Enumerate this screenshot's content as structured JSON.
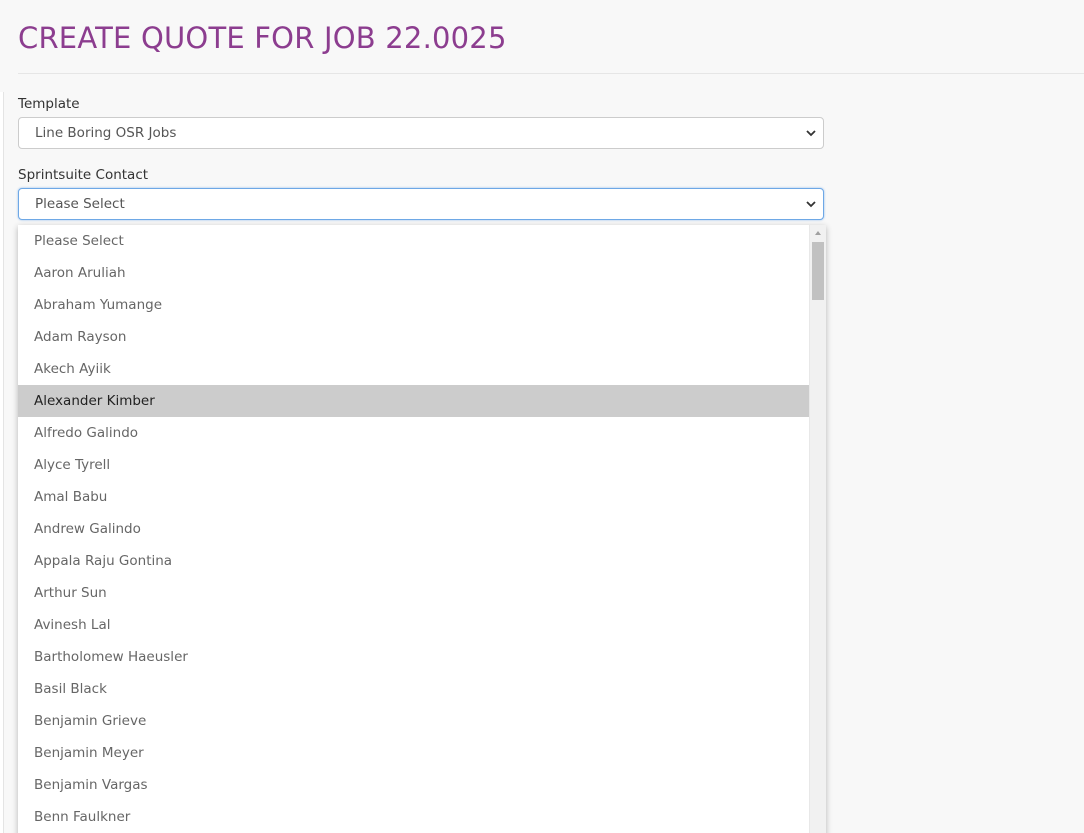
{
  "header": {
    "title": "CREATE QUOTE FOR JOB 22.0025"
  },
  "form": {
    "template": {
      "label": "Template",
      "value": "Line Boring OSR Jobs"
    },
    "contact": {
      "label": "Sprintsuite Contact",
      "value": "Please Select"
    }
  },
  "dropdown": {
    "highlighted_index": 5,
    "options": [
      "Please Select",
      "Aaron Aruliah",
      "Abraham Yumange",
      "Adam Rayson",
      "Akech Ayiik",
      "Alexander Kimber",
      "Alfredo Galindo",
      "Alyce Tyrell",
      "Amal Babu",
      "Andrew Galindo",
      "Appala Raju Gontina",
      "Arthur Sun",
      "Avinesh Lal",
      "Bartholomew Haeusler",
      "Basil Black",
      "Benjamin Grieve",
      "Benjamin Meyer",
      "Benjamin Vargas",
      "Benn Faulkner"
    ]
  },
  "colors": {
    "title": "#8c3d8f",
    "focus_border": "#6ea8e6",
    "highlight": "#cccccc"
  },
  "icons": {
    "select_arrow": "chevron-down-icon",
    "scroll_up": "arrow-up-icon"
  }
}
